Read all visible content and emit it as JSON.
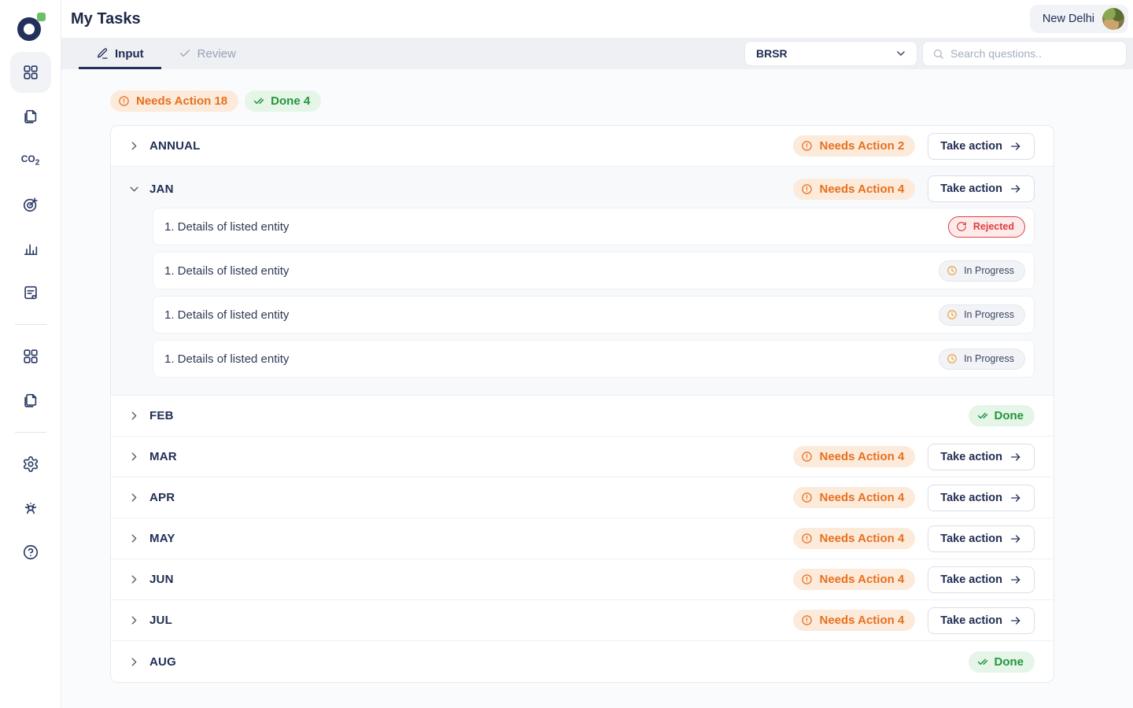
{
  "app": {
    "title": "My Tasks",
    "location_label": "New Delhi"
  },
  "tabs": [
    {
      "label": "Input",
      "icon": "pencil-icon",
      "active": true
    },
    {
      "label": "Review",
      "icon": "check-icon",
      "active": false
    }
  ],
  "filter": {
    "selected": "BRSR"
  },
  "search": {
    "placeholder": "Search questions.."
  },
  "summary": {
    "needs_action": {
      "label": "Needs Action 18",
      "icon": "alert-circle-icon"
    },
    "done": {
      "label": "Done 4",
      "icon": "double-check-icon"
    }
  },
  "sidebar": {
    "groups": [
      [
        {
          "name": "dashboard-icon",
          "icon": "grid",
          "active": true
        },
        {
          "name": "documents-icon",
          "icon": "pages",
          "active": false
        },
        {
          "name": "co2-icon",
          "icon": "co2",
          "active": false
        },
        {
          "name": "targets-icon",
          "icon": "target",
          "active": false
        },
        {
          "name": "analytics-icon",
          "icon": "barchart",
          "active": false
        },
        {
          "name": "reports-icon",
          "icon": "doc",
          "active": false
        }
      ],
      [
        {
          "name": "apps-icon",
          "icon": "grid",
          "active": false
        },
        {
          "name": "files-icon",
          "icon": "pages",
          "active": false
        }
      ],
      [
        {
          "name": "settings-icon",
          "icon": "gear",
          "active": false
        },
        {
          "name": "team-icon",
          "icon": "people",
          "active": false
        },
        {
          "name": "help-icon",
          "icon": "help",
          "active": false
        }
      ]
    ]
  },
  "actions": {
    "take_action_label": "Take action"
  },
  "statuses": {
    "rejected": {
      "label": "Rejected",
      "icon": "retry-icon"
    },
    "in_progress": {
      "label": "In Progress",
      "icon": "clock-icon"
    }
  },
  "sections": [
    {
      "label": "ANNUAL",
      "expanded": false,
      "badge": {
        "type": "needs_action",
        "label": "Needs Action 2"
      },
      "has_action": true
    },
    {
      "label": "JAN",
      "expanded": true,
      "badge": {
        "type": "needs_action",
        "label": "Needs Action 4"
      },
      "has_action": true,
      "questions": [
        {
          "text": "1. Details of listed entity",
          "status": "rejected"
        },
        {
          "text": "1. Details of listed entity",
          "status": "in_progress"
        },
        {
          "text": "1. Details of listed entity",
          "status": "in_progress"
        },
        {
          "text": "1. Details of listed entity",
          "status": "in_progress"
        }
      ]
    },
    {
      "label": "FEB",
      "expanded": false,
      "badge": {
        "type": "done",
        "label": "Done"
      },
      "has_action": false
    },
    {
      "label": "MAR",
      "expanded": false,
      "badge": {
        "type": "needs_action",
        "label": "Needs Action 4"
      },
      "has_action": true
    },
    {
      "label": "APR",
      "expanded": false,
      "badge": {
        "type": "needs_action",
        "label": "Needs Action 4"
      },
      "has_action": true
    },
    {
      "label": "MAY",
      "expanded": false,
      "badge": {
        "type": "needs_action",
        "label": "Needs Action 4"
      },
      "has_action": true
    },
    {
      "label": "JUN",
      "expanded": false,
      "badge": {
        "type": "needs_action",
        "label": "Needs Action 4"
      },
      "has_action": true
    },
    {
      "label": "JUL",
      "expanded": false,
      "badge": {
        "type": "needs_action",
        "label": "Needs Action 4"
      },
      "has_action": true
    },
    {
      "label": "AUG",
      "expanded": false,
      "badge": {
        "type": "done",
        "label": "Done"
      },
      "has_action": false
    }
  ],
  "colors": {
    "navy": "#222e55",
    "orange": "#e7701d",
    "orange_bg": "#fceadb",
    "green": "#23963c",
    "green_bg": "#e5f5e8",
    "red": "#e03c3c",
    "red_bg": "#fdebeb",
    "brand_green": "#6abf69"
  }
}
